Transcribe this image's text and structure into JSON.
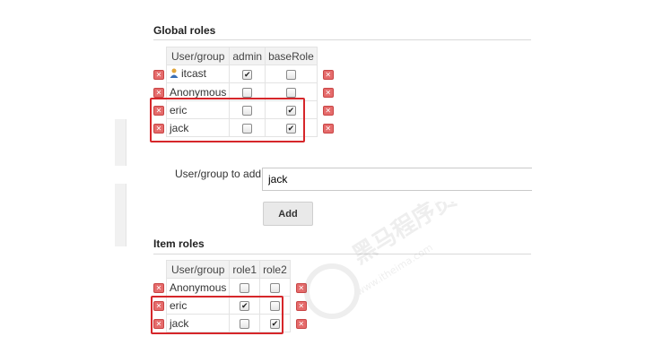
{
  "global_roles": {
    "title": "Global roles",
    "headers": [
      "User/group",
      "admin",
      "baseRole"
    ],
    "rows": [
      {
        "name": "itcast",
        "has_user_icon": true,
        "checks": [
          true,
          false
        ]
      },
      {
        "name": "Anonymous",
        "has_user_icon": false,
        "checks": [
          false,
          false
        ]
      },
      {
        "name": "eric",
        "has_user_icon": false,
        "checks": [
          false,
          true
        ]
      },
      {
        "name": "jack",
        "has_user_icon": false,
        "checks": [
          false,
          true
        ]
      }
    ]
  },
  "add_user": {
    "label": "User/group to add",
    "value": "jack",
    "button_label": "Add"
  },
  "item_roles": {
    "title": "Item roles",
    "headers": [
      "User/group",
      "role1",
      "role2"
    ],
    "rows": [
      {
        "name": "Anonymous",
        "checks": [
          false,
          false
        ]
      },
      {
        "name": "eric",
        "checks": [
          true,
          false
        ]
      },
      {
        "name": "jack",
        "checks": [
          false,
          true
        ]
      }
    ]
  },
  "icons": {
    "remove": "remove-icon",
    "user": "user-icon",
    "checkbox": "checkbox"
  },
  "colors": {
    "highlight": "#d6262a",
    "remove": "#e56b6b"
  },
  "watermark": {
    "text": "黑马程序员",
    "subtext": "www.itheima.com"
  }
}
